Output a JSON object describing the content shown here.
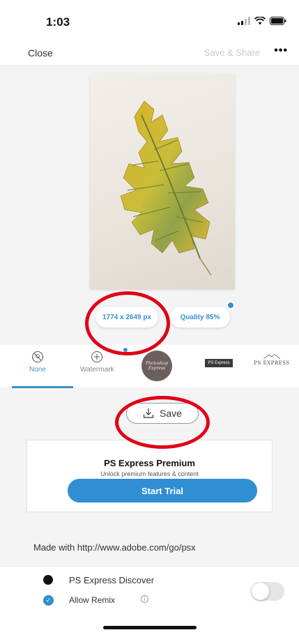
{
  "status_bar": {
    "time": "1:03"
  },
  "nav": {
    "close_label": "Close",
    "share_label": "Save & Share",
    "more_label": "•••"
  },
  "image_info": {
    "size_label": "1774 x 2649 px",
    "quality_label": "Quality 85%"
  },
  "watermarks": {
    "items": [
      {
        "label": "None",
        "icon": "no-watermark-icon",
        "selected": true
      },
      {
        "label": "Watermark",
        "icon": "add-watermark-icon",
        "selected": false
      },
      {
        "label": "Photoshop Express",
        "icon": "stamp-watermark"
      },
      {
        "label": "PS Express",
        "icon": "ps-dark-watermark"
      },
      {
        "label": "PS EXPRESS",
        "icon": "ps-serif-watermark"
      }
    ]
  },
  "save": {
    "label": "Save"
  },
  "premium": {
    "title": "PS Express Premium",
    "subtitle": "Unlock premium features & content",
    "trial_label": "Start Trial"
  },
  "made_with": "Made with http://www.adobe.com/go/psx",
  "discover": {
    "label": "PS Express Discover",
    "toggle_on": false
  },
  "remix": {
    "label": "Allow Remix",
    "checked": true
  },
  "colors": {
    "accent": "#2f8fd2",
    "annotation_red": "#e00016"
  }
}
